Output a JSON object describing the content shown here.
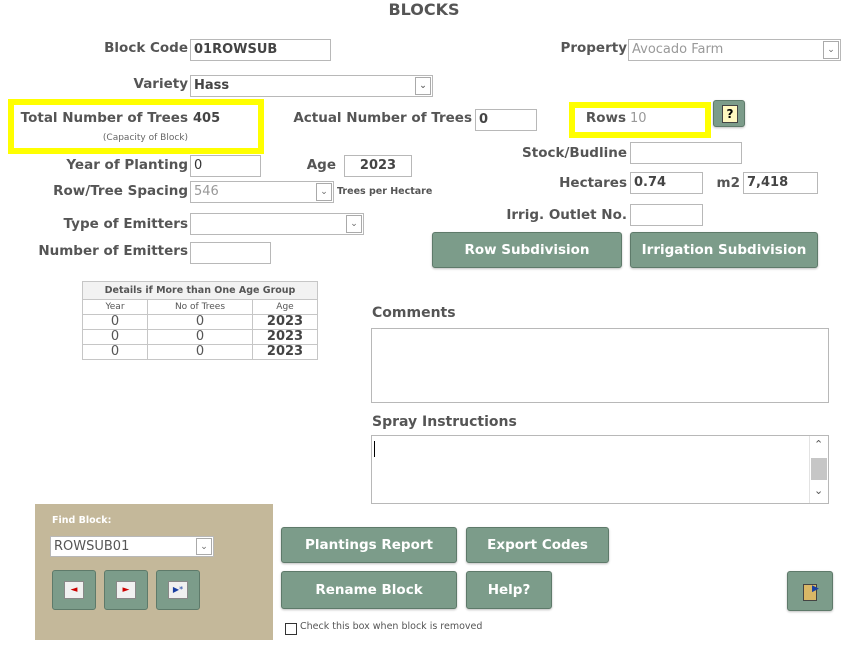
{
  "title": "BLOCKS",
  "fields": {
    "block_code": {
      "label": "Block Code",
      "value": "01ROWSUB"
    },
    "property": {
      "label": "Property",
      "value": "Avocado Farm"
    },
    "variety": {
      "label": "Variety",
      "value": "Hass"
    },
    "total_trees": {
      "label": "Total Number of Trees",
      "sublabel": "(Capacity of Block)",
      "value": "405"
    },
    "actual_trees": {
      "label": "Actual Number of Trees",
      "value": "0"
    },
    "rows": {
      "label": "Rows",
      "value": "10"
    },
    "year_planting": {
      "label": "Year of Planting",
      "value": "0"
    },
    "age": {
      "label": "Age",
      "value": "2023"
    },
    "stock": {
      "label": "Stock/Budline",
      "value": ""
    },
    "row_spacing": {
      "label": "Row/Tree Spacing",
      "value": "546",
      "suffix": "Trees per Hectare"
    },
    "hectares": {
      "label": "Hectares",
      "value": "0.74"
    },
    "m2": {
      "label": "m2",
      "value": "7,418"
    },
    "emitter_type": {
      "label": "Type of Emitters",
      "value": ""
    },
    "irrig_outlet": {
      "label": "Irrig. Outlet No.",
      "value": ""
    },
    "num_emitters": {
      "label": "Number of Emitters",
      "value": ""
    }
  },
  "buttons": {
    "help_icon": "?",
    "row_subdivision": "Row Subdivision",
    "irrigation_subdivision": "Irrigation Subdivision",
    "plantings_report": "Plantings Report",
    "export_codes": "Export Codes",
    "rename_block": "Rename Block",
    "help": "Help?"
  },
  "age_table": {
    "caption": "Details if More than One Age Group",
    "headers": [
      "Year",
      "No of Trees",
      "Age"
    ],
    "rows": [
      [
        "0",
        "0",
        "2023"
      ],
      [
        "0",
        "0",
        "2023"
      ],
      [
        "0",
        "0",
        "2023"
      ]
    ]
  },
  "comments": {
    "label": "Comments",
    "value": ""
  },
  "spray": {
    "label": "Spray Instructions",
    "value": ""
  },
  "find_block": {
    "label": "Find Block:",
    "value": "ROWSUB01"
  },
  "nav": {
    "prev": "◄",
    "next": "►",
    "new": "▶*"
  },
  "removed_checkbox": {
    "label": "Check this box when block is removed",
    "checked": false
  },
  "colors": {
    "button": "#7c9c8a",
    "panel": "#c4b89a",
    "highlight": "#ffff00"
  }
}
